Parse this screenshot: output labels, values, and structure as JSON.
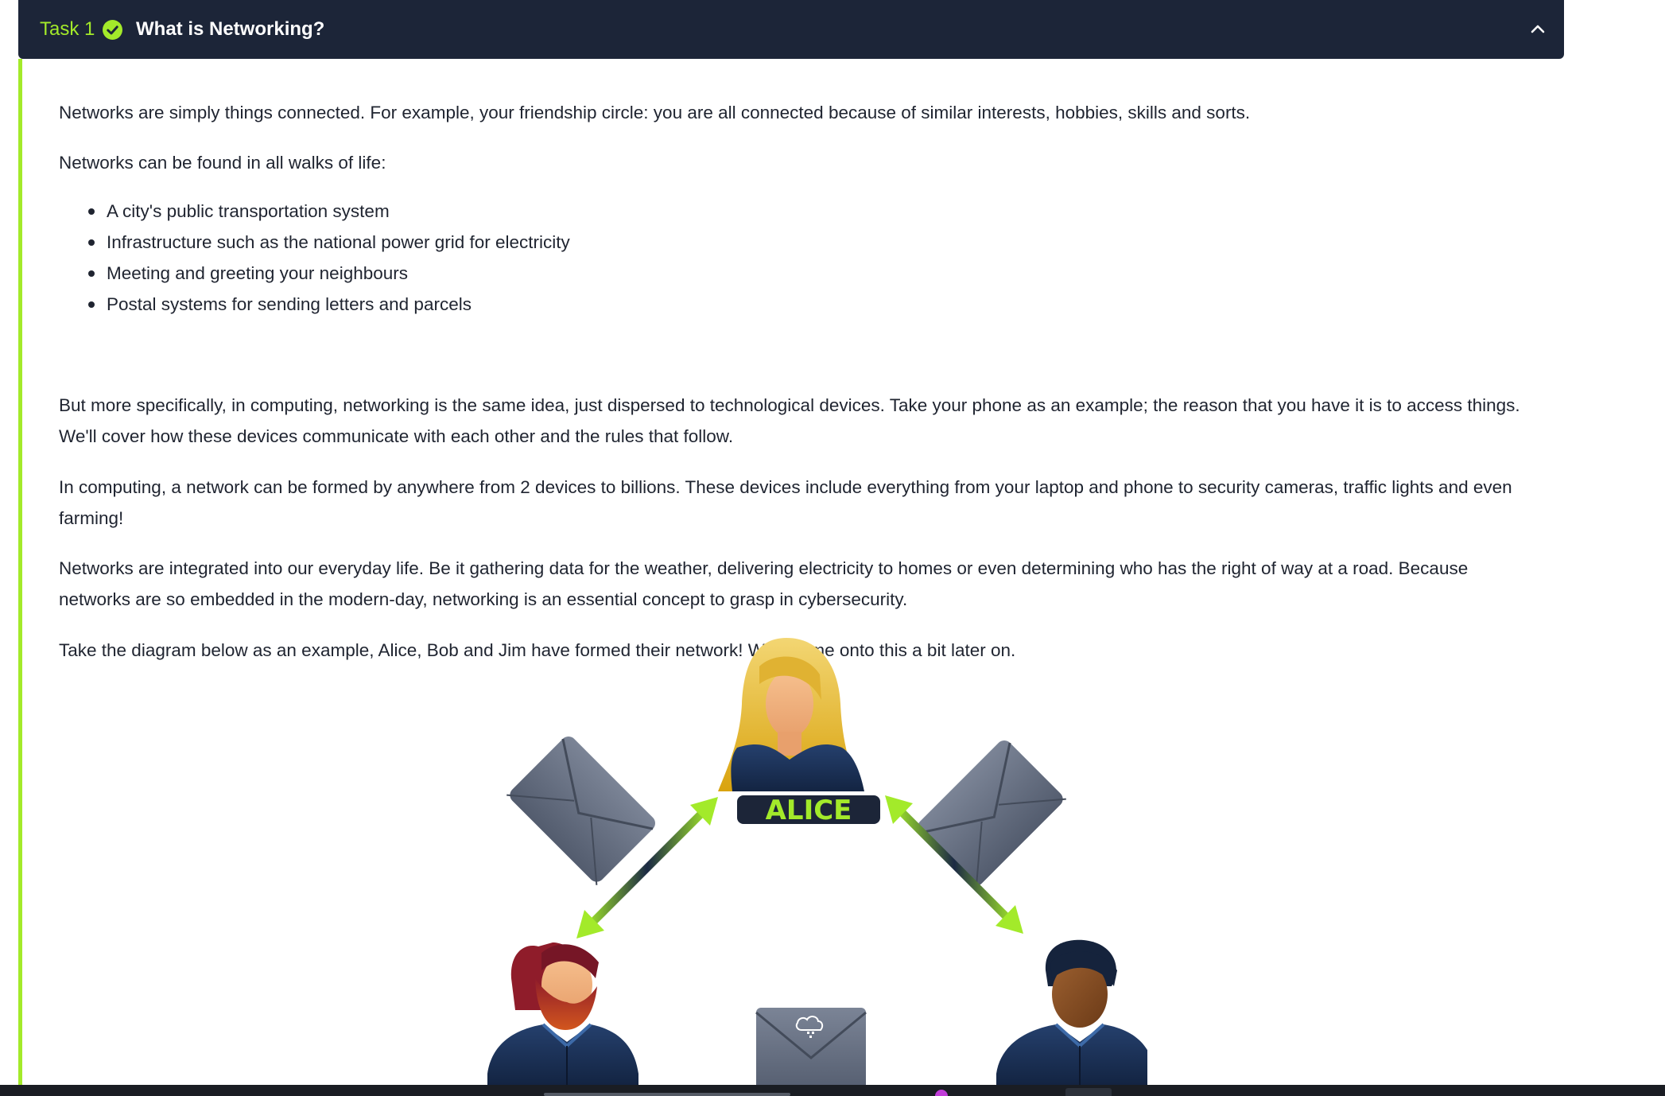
{
  "task": {
    "number_label": "Task 1",
    "status_icon": "check-circle-icon",
    "title": "What is Networking?",
    "collapse_icon": "chevron-up-icon",
    "accent_color": "#a3ea2a",
    "header_color": "#1c2538"
  },
  "content": {
    "p1": "Networks are simply things connected. For example, your friendship circle: you are all connected because of similar interests, hobbies, skills and sorts.",
    "p2": "Networks can be found in all walks of life:",
    "bullets": [
      "A city's public transportation system",
      "Infrastructure such as the national power grid for electricity",
      "Meeting and greeting your neighbours",
      "Postal systems for sending letters and parcels"
    ],
    "p3_line1": "But more specifically, in computing, networking is the same idea, just dispersed to technological devices. Take your phone as an example; the reason that you have it is to access things.",
    "p3_line2": "We'll cover how these devices communicate with each other and the rules that follow.",
    "p4_line1": "In computing, a network can be formed by anywhere from 2 devices to billions. These devices include everything from your laptop and phone to security cameras, traffic lights and even",
    "p4_line2": "farming!",
    "p5_line1": "Networks are integrated into our everyday life. Be it gathering data for the weather, delivering electricity to homes or even determining who has the right of way at a road. Because",
    "p5_line2": "networks are so embedded in the modern-day, networking is an essential concept to grasp in cybersecurity.",
    "p6": "Take the diagram below as an example, Alice, Bob and Jim have formed their network! We'll come onto this a bit later on."
  },
  "diagram": {
    "alice_label": "ALICE",
    "icons": [
      "person-alice-icon",
      "person-bob-icon",
      "person-jim-icon",
      "envelope-icon",
      "cloud-icon",
      "double-arrow-icon"
    ]
  }
}
